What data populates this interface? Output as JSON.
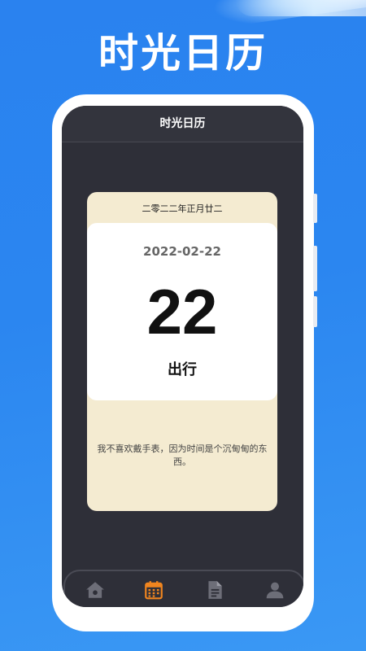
{
  "promo": {
    "title": "时光日历"
  },
  "app": {
    "title": "时光日历"
  },
  "calendar": {
    "lunar_date": "二零二二年正月廿二",
    "date": "2022-02-22",
    "day": "22",
    "activity": "出行",
    "quote": "我不喜欢戴手表，因为时间是个沉甸甸的东西。"
  },
  "tabs": [
    {
      "icon": "home-icon",
      "active": false
    },
    {
      "icon": "calendar-icon",
      "active": true
    },
    {
      "icon": "document-icon",
      "active": false
    },
    {
      "icon": "user-icon",
      "active": false
    }
  ],
  "colors": {
    "background": "#2b86f0",
    "screen": "#2e2f38",
    "card": "#f4ebd1",
    "active_tab": "#f0851f",
    "inactive_tab": "#6d6e78"
  }
}
